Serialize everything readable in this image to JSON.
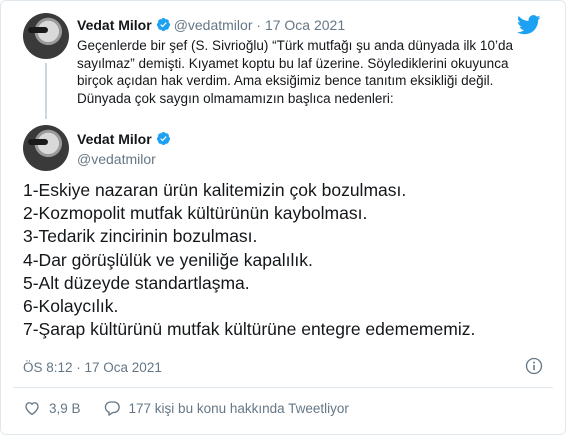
{
  "quoted_tweet": {
    "display_name": "Vedat Milor",
    "handle": "@vedatmilor",
    "separator": "·",
    "date": "17 Oca 2021",
    "text": "Geçenlerde bir şef (S. Sivrioğlu) “Türk mutfağı şu anda dünyada ilk 10’da sayılmaz” demişti. Kıyamet koptu bu laf üzerine. Söylediklerini okuyunca birçok açıdan hak verdim. Ama eksiğimiz bence tanıtım eksikliği değil. Dünyada çok saygın olmamamızın başlıca nedenleri:"
  },
  "main_tweet": {
    "display_name": "Vedat Milor",
    "handle": "@vedatmilor",
    "lines": [
      "1-Eskiye nazaran ürün kalitemizin çok bozulması.",
      "2-Kozmopolit mutfak kültürünün kaybolması.",
      "3-Tedarik zincirinin bozulması.",
      "4-Dar görüşlülük ve yeniliğe kapalılık.",
      "5-Alt düzeyde standartlaşma.",
      "6-Kolaycılık.",
      "7-Şarap kültürünü mutfak kültürüne entegre edemememiz."
    ],
    "timestamp": "ÖS 8:12 · 17 Oca 2021",
    "likes": "3,9 B",
    "replies_label": "177 kişi bu konu hakkında Tweetliyor"
  },
  "icons": {
    "brand": "twitter-bird-icon",
    "verified": "verified-badge-icon",
    "info": "info-icon",
    "like": "heart-icon",
    "reply": "comment-bubble-icon"
  },
  "colors": {
    "accent": "#1da1f2",
    "text": "#14171a",
    "muted": "#657786",
    "border": "#e1e8ed"
  }
}
